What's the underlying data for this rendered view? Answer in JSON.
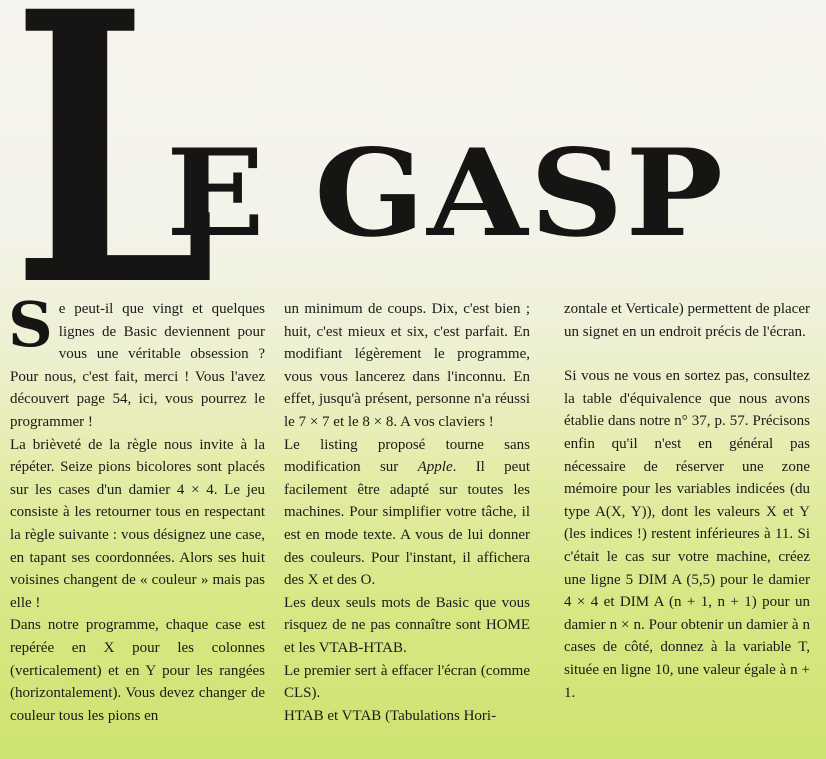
{
  "title": {
    "big_letter": "L",
    "rest": "E GASP"
  },
  "col1": {
    "dropcap": "S",
    "p1": "e peut-il que vingt et quelques lignes de Basic deviennent pour vous une véritable obsession ? Pour nous, c'est fait, merci ! Vous l'avez découvert page 54, ici, vous pourrez le programmer !",
    "p2": "La brièveté de la règle nous invite à la répéter. Seize pions bicolores sont placés sur les cases d'un damier 4 × 4. Le jeu consiste à les retourner tous en respectant la règle suivante : vous désignez une case, en tapant ses coordonnées. Alors ses huit voisines changent de « couleur » mais pas elle !",
    "p3": "Dans notre programme, chaque case est repérée en X pour les colonnes (verticalement) et en Y pour les rangées (horizontalement). Vous devez changer de couleur tous les pions en"
  },
  "col2": {
    "p1": "un minimum de coups. Dix, c'est bien ; huit, c'est mieux et six, c'est parfait. En modifiant légèrement le programme, vous vous lancerez dans l'inconnu. En effet, jusqu'à présent, personne n'a réussi le 7 × 7 et le 8 × 8. A vos claviers !",
    "p2_before": "Le listing proposé tourne sans modification sur ",
    "p2_em": "Apple",
    "p2_after": ". Il peut facilement être adapté sur toutes les machines. Pour simplifier votre tâche, il est en mode texte. A vous de lui donner des couleurs. Pour l'instant, il affichera des X et des O.",
    "p3": "Les deux seuls mots de Basic que vous risquez de ne pas connaître sont HOME et les VTAB-HTAB.",
    "p4": "Le premier sert à effacer l'écran (comme CLS).",
    "p5": "HTAB et VTAB (Tabulations Hori-"
  },
  "col3": {
    "p1": "zontale et Verticale) permettent de placer un signet en un endroit précis de l'écran.",
    "p2": "Si vous ne vous en sortez pas, consultez la table d'équivalence que nous avons établie dans notre n° 37, p. 57. Précisons enfin qu'il n'est en général pas nécessaire de réserver une zone mémoire pour les variables indicées (du type A(X, Y)), dont les valeurs X et Y (les indices !) restent inférieures à 11. Si c'était le cas sur votre machine, créez une ligne 5 DIM A (5,5) pour le damier 4 × 4 et DIM A (n + 1, n + 1) pour un damier n × n. Pour obtenir un damier à n cases de côté, donnez à la variable T, située en ligne 10, une valeur égale à n + 1."
  }
}
